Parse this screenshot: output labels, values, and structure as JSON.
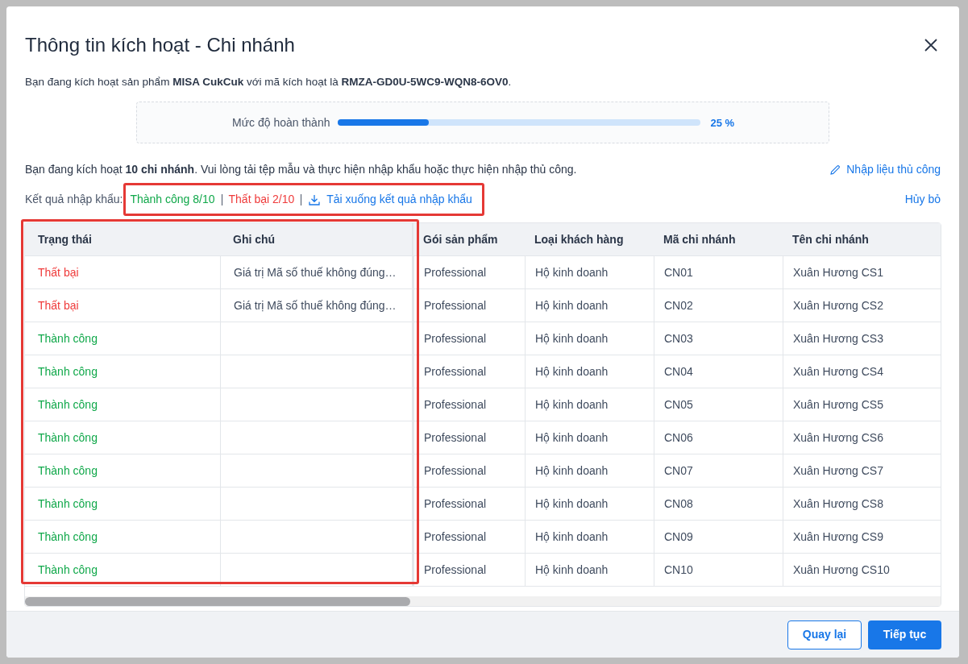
{
  "dialog": {
    "title": "Thông tin kích hoạt - Chi nhánh"
  },
  "intro": "Bạn đang kích hoạt sản phẩm **MISA CukCuk** với mã kích hoạt là **RMZA-GD0U-5WC9-WQN8-6OV0**.",
  "progress": {
    "label": "Mức độ hoàn thành",
    "level": 0.25,
    "reading": "25 %"
  },
  "instruction": "Bạn đang kích hoạt **10 chi nhánh**. Vui lòng tải tệp mẫu và thực hiện nhập khẩu hoặc thực hiện nhập thủ công.",
  "manual_entry_link": "Nhập liệu thủ công",
  "import_result": {
    "label": "Kết quả nhập khẩu:",
    "success": "Thành công 8/10",
    "failed": "Thất bại 2/10",
    "download_link": "Tải xuống kết quả nhập khẩu",
    "highlighted": true
  },
  "cancel_link": "Hủy bỏ",
  "table": {
    "highlighted_columns": true,
    "columns": [
      "Trạng thái",
      "Ghi chú",
      "Gói sản phẩm",
      "Loại khách hàng",
      "Mã chi nhánh",
      "Tên chi nhánh"
    ],
    "rows": [
      {
        "status": "Thất bại",
        "kind": "failed",
        "note": "Giá trị Mã số thuế không đúng…",
        "package": "Professional",
        "customer_type": "Hộ kinh doanh",
        "branch_code": "CN01",
        "branch_name": "Xuân Hương CS1"
      },
      {
        "status": "Thất bại",
        "kind": "failed",
        "note": "Giá trị Mã số thuế không đúng…",
        "package": "Professional",
        "customer_type": "Hộ kinh doanh",
        "branch_code": "CN02",
        "branch_name": "Xuân Hương CS2"
      },
      {
        "status": "Thành công",
        "kind": "success",
        "package": "Professional",
        "customer_type": "Hộ kinh doanh",
        "branch_code": "CN03",
        "branch_name": "Xuân Hương CS3"
      },
      {
        "status": "Thành công",
        "kind": "success",
        "package": "Professional",
        "customer_type": "Hộ kinh doanh",
        "branch_code": "CN04",
        "branch_name": "Xuân Hương CS4"
      },
      {
        "status": "Thành công",
        "kind": "success",
        "package": "Professional",
        "customer_type": "Hộ kinh doanh",
        "branch_code": "CN05",
        "branch_name": "Xuân Hương CS5"
      },
      {
        "status": "Thành công",
        "kind": "success",
        "package": "Professional",
        "customer_type": "Hộ kinh doanh",
        "branch_code": "CN06",
        "branch_name": "Xuân Hương CS6"
      },
      {
        "status": "Thành công",
        "kind": "success",
        "package": "Professional",
        "customer_type": "Hộ kinh doanh",
        "branch_code": "CN07",
        "branch_name": "Xuân Hương CS7"
      },
      {
        "status": "Thành công",
        "kind": "success",
        "package": "Professional",
        "customer_type": "Hộ kinh doanh",
        "branch_code": "CN08",
        "branch_name": "Xuân Hương CS8"
      },
      {
        "status": "Thành công",
        "kind": "success",
        "package": "Professional",
        "customer_type": "Hộ kinh doanh",
        "branch_code": "CN09",
        "branch_name": "Xuân Hương CS9"
      },
      {
        "status": "Thành công",
        "kind": "success",
        "package": "Professional",
        "customer_type": "Hộ kinh doanh",
        "branch_code": "CN10",
        "branch_name": "Xuân Hương CS10"
      }
    ]
  },
  "buttons": {
    "back": "Quay lại",
    "next": "Tiếp tục"
  }
}
